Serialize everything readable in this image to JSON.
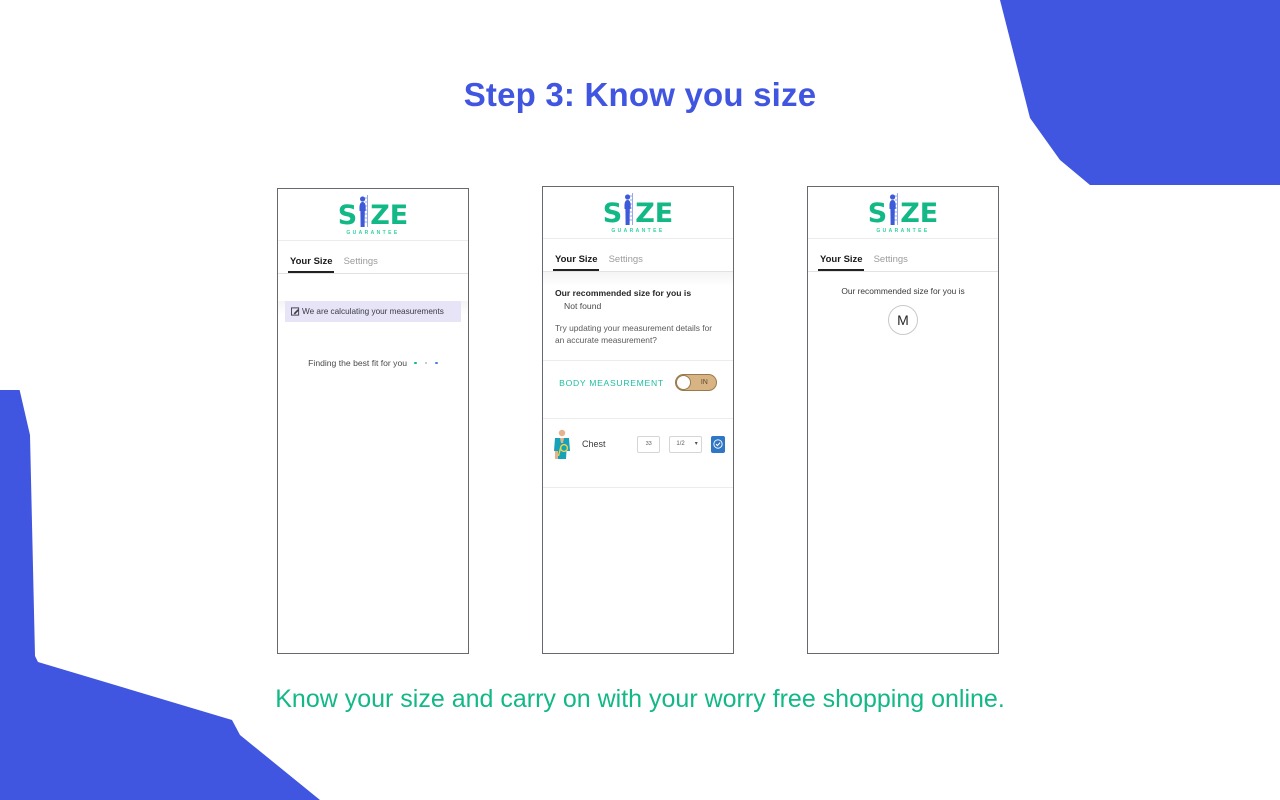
{
  "page": {
    "title": "Step 3: Know you size",
    "caption": "Know your size and carry on with your worry free shopping online.",
    "title_color": "#4055e0",
    "caption_color": "#12b886",
    "decor_color": "#4055e0",
    "background": "#ffffff"
  },
  "brand": {
    "logo_first": "S",
    "logo_rest": "ZE",
    "tagline": "GUARANTEE",
    "figure_icon": "person-ruler-icon",
    "green": "#12b886",
    "blue": "#3d5bd9"
  },
  "tabs": {
    "your_size": "Your Size",
    "settings": "Settings"
  },
  "phone1": {
    "banner_text": "We are calculating your measurements",
    "banner_icon": "pencil-edit-icon",
    "banner_bg": "#e6e4f6",
    "loading_text": "Finding the best fit for you",
    "dot_colors": [
      "#12b886",
      "#b9b9b9",
      "#4a7fe0"
    ]
  },
  "phone2": {
    "rec_label": "Our recommended size for you is",
    "rec_value": "Not found",
    "hint": "Try updating your measurement details for an accurate measurement?",
    "body_measurement_label": "BODY MEASUREMENT",
    "unit_toggle": "IN",
    "toggle_color": "#d8b383",
    "measurement": {
      "icon": "body-figure-icon",
      "name": "Chest",
      "value": "33",
      "fraction": "1/2",
      "fraction_chevron": "chevron-down-icon",
      "confirm_icon": "check-circle-icon",
      "confirm_color": "#2f76c4"
    }
  },
  "phone3": {
    "rec_label": "Our recommended size for you is",
    "size_value": "M"
  }
}
